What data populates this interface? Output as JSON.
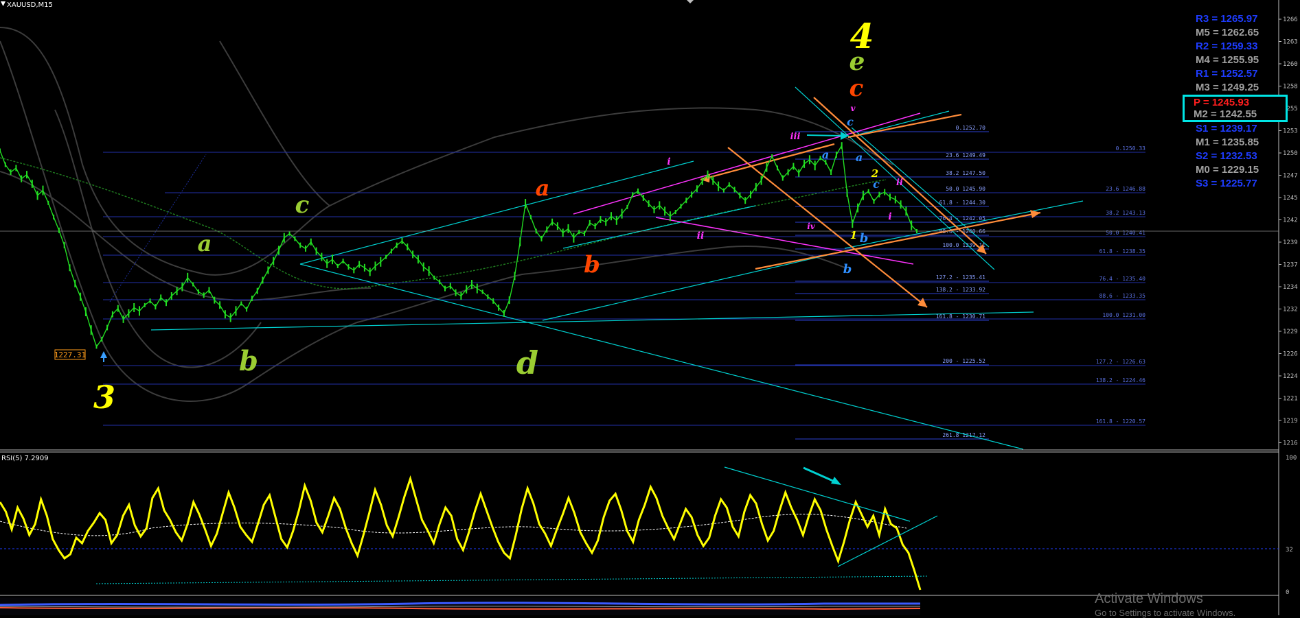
{
  "header": {
    "symbol_label": "XAUUSD,M15"
  },
  "indicator": {
    "label": "RSI(5) 7.2909",
    "levels": [
      "100",
      "32",
      "0"
    ]
  },
  "low_label": "1227.31",
  "colors": {
    "background": "#000000",
    "candle": "#22dd22",
    "rsi": "#ffff00",
    "fib": "#2b3fcf",
    "cyan": "#00d0d0",
    "orange": "#ff8c3a",
    "magenta": "#ff33ff",
    "pivot_blue": "#1e3cff",
    "pivot_gray": "#a0a0a0",
    "pivot_red": "#ff1e1e"
  },
  "pivots": [
    {
      "label": "R3 = 1265.97",
      "color": "#1e3cff"
    },
    {
      "label": "M5 = 1262.65",
      "color": "#a0a0a0"
    },
    {
      "label": "R2 = 1259.33",
      "color": "#1e3cff"
    },
    {
      "label": "M4 = 1255.95",
      "color": "#a0a0a0"
    },
    {
      "label": "R1 = 1252.57",
      "color": "#1e3cff"
    },
    {
      "label": "M3 = 1249.25",
      "color": "#a0a0a0"
    },
    {
      "label": "P   = 1245.93",
      "color": "#ff1e1e",
      "highlight": true
    },
    {
      "label": "M2 = 1242.55",
      "color": "#a0a0a0"
    },
    {
      "label": "S1 = 1239.17",
      "color": "#1e3cff"
    },
    {
      "label": "M1 = 1235.85",
      "color": "#a0a0a0"
    },
    {
      "label": "S2 = 1232.53",
      "color": "#1e3cff"
    },
    {
      "label": "M0 = 1229.15",
      "color": "#a0a0a0"
    },
    {
      "label": "S3 = 1225.77",
      "color": "#1e3cff"
    }
  ],
  "fib_levels_right": [
    "0.1252.70",
    "23.6 1249.49",
    "38.2 1247.50",
    "50.0 1245.90",
    "61.8 - 1244.30",
    "76.4 - 1242.05",
    "88.6 - 1240.66",
    "100.0 1239.11",
    "127.2 - 1235.41",
    "138.2 - 1233.92",
    "161.8 - 1230.71",
    "200 - 1225.52",
    "261.8 1217.12"
  ],
  "fib_levels_far": [
    "0.1250.33",
    "23.6 1246.88",
    "38.2 1243.13",
    "50.0 1240.41",
    "61.8 - 1238.35",
    "76.4 - 1235.40",
    "88.6 - 1233.35",
    "100.0 1231.00",
    "127.2 - 1226.63",
    "138.2 - 1224.46",
    "161.8 - 1220.57"
  ],
  "wave_labels": [
    {
      "text": "3",
      "color": "#ffff00"
    },
    {
      "text": "a",
      "color": "#9acd32"
    },
    {
      "text": "b",
      "color": "#9acd32"
    },
    {
      "text": "c",
      "color": "#9acd32"
    },
    {
      "text": "d",
      "color": "#9acd32"
    },
    {
      "text": "a",
      "color": "#ff4500"
    },
    {
      "text": "b",
      "color": "#ff4500"
    },
    {
      "text": "4",
      "color": "#ffff00"
    },
    {
      "text": "e",
      "color": "#9acd32"
    },
    {
      "text": "c",
      "color": "#ff4500"
    },
    {
      "text": "c",
      "color": "#2f8fff"
    },
    {
      "text": "b",
      "color": "#2f8fff"
    },
    {
      "text": "a",
      "color": "#2f8fff"
    },
    {
      "text": "a",
      "color": "#2f8fff"
    },
    {
      "text": "b",
      "color": "#2f8fff"
    },
    {
      "text": "c",
      "color": "#2f8fff"
    },
    {
      "text": "i",
      "color": "#ff33ff"
    },
    {
      "text": "ii",
      "color": "#ff33ff"
    },
    {
      "text": "iii",
      "color": "#ff33ff"
    },
    {
      "text": "iv",
      "color": "#ff33ff"
    },
    {
      "text": "v",
      "color": "#ff33ff"
    },
    {
      "text": "i",
      "color": "#ff33ff"
    },
    {
      "text": "ii",
      "color": "#ff33ff"
    },
    {
      "text": "1",
      "color": "#ffff00"
    },
    {
      "text": "2",
      "color": "#ffff00"
    }
  ],
  "watermark": {
    "title": "Activate Windows",
    "subtitle": "Go to Settings to activate Windows."
  },
  "chart_data": {
    "type": "line",
    "title": "XAUUSD,M15",
    "xlabel": "",
    "ylabel": "",
    "y_ticks": [
      "1266",
      "1263",
      "1260",
      "1258",
      "1255",
      "1253",
      "1250",
      "1247",
      "1245",
      "1242",
      "1239",
      "1237",
      "1234",
      "1232",
      "1229",
      "1226",
      "1224",
      "1221",
      "1219",
      "1216"
    ],
    "ylim": [
      1215.5,
      1267.5
    ],
    "current_price": 1241.5,
    "price_series": [
      1251.2,
      1249.5,
      1248.6,
      1249.1,
      1247.8,
      1248.3,
      1247.2,
      1245.8,
      1246.4,
      1244.9,
      1243.2,
      1241.6,
      1239.8,
      1237.1,
      1235.2,
      1233.6,
      1231.8,
      1229.6,
      1227.6,
      1228.5,
      1229.9,
      1231.5,
      1232.2,
      1230.9,
      1231.6,
      1232.3,
      1231.9,
      1232.6,
      1233.1,
      1232.4,
      1233.5,
      1232.9,
      1233.7,
      1234.3,
      1234.8,
      1235.9,
      1235.1,
      1234.2,
      1233.8,
      1234.4,
      1233.2,
      1232.6,
      1231.5,
      1231.1,
      1231.9,
      1232.8,
      1232.1,
      1233.4,
      1234.3,
      1235.6,
      1236.8,
      1237.9,
      1239.2,
      1240.7,
      1241.2,
      1240.6,
      1239.8,
      1239.4,
      1240.2,
      1239.1,
      1238.4,
      1237.6,
      1238.1,
      1237.3,
      1237.9,
      1237.2,
      1236.8,
      1237.5,
      1237.1,
      1236.6,
      1237.3,
      1237.8,
      1238.4,
      1239.1,
      1239.8,
      1240.3,
      1239.6,
      1238.7,
      1238.1,
      1237.2,
      1236.7,
      1235.9,
      1235.4,
      1234.6,
      1234.9,
      1234.1,
      1233.7,
      1234.5,
      1235.1,
      1234.6,
      1234.2,
      1233.6,
      1233.1,
      1232.3,
      1231.6,
      1233.2,
      1236.1,
      1240.2,
      1244.8,
      1243.2,
      1241.5,
      1240.6,
      1241.7,
      1242.6,
      1242.1,
      1241.3,
      1241.8,
      1240.7,
      1241.4,
      1241.2,
      1242.5,
      1242.1,
      1242.9,
      1242.6,
      1243.3,
      1242.8,
      1243.6,
      1244.4,
      1245.9,
      1246.3,
      1245.5,
      1244.8,
      1244.1,
      1244.6,
      1243.9,
      1243.3,
      1243.8,
      1244.5,
      1245.2,
      1245.9,
      1246.6,
      1247.5,
      1248.3,
      1247.6,
      1246.9,
      1246.4,
      1247.1,
      1246.5,
      1245.8,
      1245.2,
      1245.9,
      1246.8,
      1247.6,
      1249.2,
      1250.5,
      1249.1,
      1247.9,
      1248.6,
      1249.3,
      1248.5,
      1249.6,
      1250.1,
      1249.4,
      1250.3,
      1249.8,
      1248.6,
      1250.7,
      1251.8,
      1246.1,
      1242.4,
      1244.3,
      1245.8,
      1246.3,
      1245.1,
      1245.9,
      1246.2,
      1245.6,
      1245.3,
      1244.7,
      1243.9,
      1242.2,
      1241.5
    ],
    "rsi_series": [
      68,
      61,
      48,
      64,
      56,
      44,
      52,
      70,
      58,
      41,
      33,
      27,
      30,
      42,
      38,
      47,
      53,
      60,
      55,
      38,
      44,
      58,
      66,
      51,
      43,
      49,
      71,
      78,
      62,
      55,
      46,
      40,
      52,
      68,
      59,
      48,
      36,
      45,
      60,
      75,
      64,
      50,
      44,
      39,
      52,
      66,
      73,
      57,
      41,
      35,
      47,
      62,
      80,
      69,
      53,
      46,
      58,
      71,
      63,
      49,
      38,
      29,
      44,
      60,
      77,
      66,
      51,
      43,
      57,
      72,
      85,
      70,
      55,
      47,
      38,
      52,
      64,
      58,
      41,
      33,
      46,
      61,
      74,
      62,
      50,
      39,
      31,
      27,
      44,
      63,
      78,
      67,
      52,
      45,
      36,
      48,
      59,
      71,
      60,
      46,
      38,
      31,
      40,
      57,
      69,
      74,
      62,
      47,
      39,
      55,
      66,
      79,
      71,
      58,
      49,
      41,
      52,
      63,
      57,
      44,
      36,
      42,
      58,
      70,
      64,
      50,
      43,
      61,
      73,
      67,
      52,
      40,
      47,
      62,
      75,
      64,
      55,
      44,
      58,
      70,
      62,
      48,
      36,
      25,
      39,
      55,
      68,
      59,
      50,
      58,
      44,
      63,
      52,
      49,
      37,
      31,
      18,
      4
    ]
  }
}
